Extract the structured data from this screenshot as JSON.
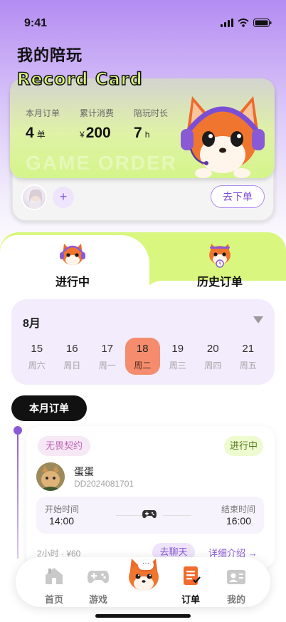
{
  "status_bar": {
    "time": "9:41"
  },
  "header": {
    "title": "我的陪玩",
    "card_title": "Record Card"
  },
  "record_card": {
    "stats": [
      {
        "label": "本月订单",
        "prefix": "",
        "value": "4",
        "unit": "单"
      },
      {
        "label": "累计消费",
        "prefix": "¥",
        "value": "200",
        "unit": ""
      },
      {
        "label": "陪玩时长",
        "prefix": "",
        "value": "7",
        "unit": "h"
      }
    ],
    "watermark": "GAME ORDER",
    "add_symbol": "+",
    "order_button": "去下单"
  },
  "tabs": [
    {
      "label": "进行中",
      "active": true
    },
    {
      "label": "历史订单",
      "active": false
    }
  ],
  "calendar": {
    "month": "8月",
    "days": [
      {
        "num": "15",
        "week": "周六"
      },
      {
        "num": "16",
        "week": "周日"
      },
      {
        "num": "17",
        "week": "周一"
      },
      {
        "num": "18",
        "week": "周二",
        "active": true
      },
      {
        "num": "19",
        "week": "周三"
      },
      {
        "num": "20",
        "week": "周四"
      },
      {
        "num": "21",
        "week": "周五"
      }
    ]
  },
  "section": {
    "title": "本月订单"
  },
  "order": {
    "tag": "无畏契约",
    "status": "进行中",
    "player_name": "蛋蛋",
    "order_id": "DD2024081701",
    "start_label": "开始时间",
    "start_time": "14:00",
    "end_label": "结束时间",
    "end_time": "16:00",
    "meta": "2小时 · ¥60",
    "chat_button": "去聊天",
    "detail_link": "详细介绍 →"
  },
  "nav": {
    "items": [
      {
        "label": "首页",
        "icon": "home-icon"
      },
      {
        "label": "游戏",
        "icon": "gamepad-icon"
      },
      {
        "label": "订单",
        "icon": "order-icon",
        "active": true
      },
      {
        "label": "我的",
        "icon": "profile-icon"
      }
    ],
    "center_bubble": "···"
  },
  "colors": {
    "accent_purple": "#8a5ad6",
    "accent_lime": "#d9f77f",
    "active_day": "#f48c6d"
  }
}
